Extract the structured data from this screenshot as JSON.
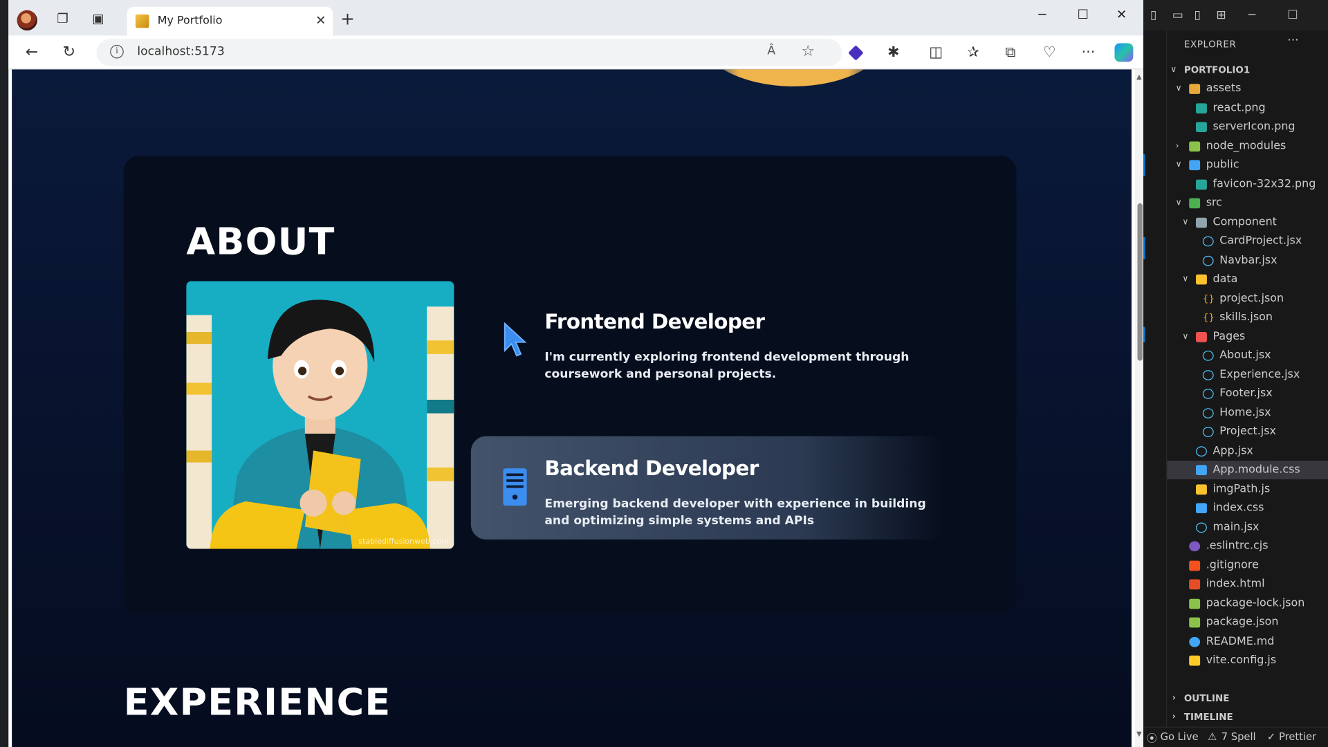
{
  "browser": {
    "tab_title": "My Portfolio",
    "new_tab_label": "+",
    "url": "localhost:5173",
    "read_aloud_label": "Â",
    "window_controls": {
      "minimize": "─",
      "maximize": "☐",
      "close": "✕"
    }
  },
  "page": {
    "about_title": "ABOUT",
    "avatar_watermark": "stablediffusionweb.com",
    "roles": [
      {
        "title": "Frontend Developer",
        "description": "I'm currently exploring frontend development through coursework and personal projects.",
        "icon": "cursor-icon"
      },
      {
        "title": "Backend Developer",
        "description": "Emerging backend developer with experience in building and optimizing simple systems and APIs",
        "icon": "server-icon"
      }
    ],
    "experience_title": "EXPERIENCE"
  },
  "vscode": {
    "explorer_label": "EXPLORER",
    "more_label": "···",
    "project_root": "PORTFOLIO1",
    "tree": [
      {
        "label": "assets",
        "depth": 1,
        "type": "folder-open",
        "color": "#e8a93b"
      },
      {
        "label": "react.png",
        "depth": 2,
        "type": "image",
        "color": "#26a69a"
      },
      {
        "label": "serverIcon.png",
        "depth": 2,
        "type": "image",
        "color": "#26a69a"
      },
      {
        "label": "node_modules",
        "depth": 1,
        "type": "folder-closed",
        "color": "#8bc34a"
      },
      {
        "label": "public",
        "depth": 1,
        "type": "folder-open",
        "color": "#42a5f5"
      },
      {
        "label": "favicon-32x32.png",
        "depth": 2,
        "type": "image",
        "color": "#26a69a"
      },
      {
        "label": "src",
        "depth": 1,
        "type": "folder-open",
        "color": "#4caf50"
      },
      {
        "label": "Component",
        "depth": 2,
        "type": "folder-open",
        "color": "#90a4ae"
      },
      {
        "label": "CardProject.jsx",
        "depth": 3,
        "type": "react",
        "color": "#4fc3f7"
      },
      {
        "label": "Navbar.jsx",
        "depth": 3,
        "type": "react",
        "color": "#4fc3f7"
      },
      {
        "label": "data",
        "depth": 2,
        "type": "folder-open",
        "color": "#fbc02d"
      },
      {
        "label": "project.json",
        "depth": 3,
        "type": "json",
        "color": "#f9a825"
      },
      {
        "label": "skills.json",
        "depth": 3,
        "type": "json",
        "color": "#f9a825"
      },
      {
        "label": "Pages",
        "depth": 2,
        "type": "folder-open",
        "color": "#ef5350"
      },
      {
        "label": "About.jsx",
        "depth": 3,
        "type": "react",
        "color": "#4fc3f7"
      },
      {
        "label": "Experience.jsx",
        "depth": 3,
        "type": "react",
        "color": "#4fc3f7"
      },
      {
        "label": "Footer.jsx",
        "depth": 3,
        "type": "react",
        "color": "#4fc3f7"
      },
      {
        "label": "Home.jsx",
        "depth": 3,
        "type": "react",
        "color": "#4fc3f7"
      },
      {
        "label": "Project.jsx",
        "depth": 3,
        "type": "react",
        "color": "#4fc3f7"
      },
      {
        "label": "App.jsx",
        "depth": 2,
        "type": "react",
        "color": "#4fc3f7"
      },
      {
        "label": "App.module.css",
        "depth": 2,
        "type": "css",
        "color": "#42a5f5",
        "selected": true
      },
      {
        "label": "imgPath.js",
        "depth": 2,
        "type": "js",
        "color": "#fbc02d"
      },
      {
        "label": "index.css",
        "depth": 2,
        "type": "css",
        "color": "#42a5f5"
      },
      {
        "label": "main.jsx",
        "depth": 2,
        "type": "react",
        "color": "#4fc3f7"
      },
      {
        "label": ".eslintrc.cjs",
        "depth": 1,
        "type": "eslint",
        "color": "#7e57c2"
      },
      {
        "label": ".gitignore",
        "depth": 1,
        "type": "git",
        "color": "#f4511e"
      },
      {
        "label": "index.html",
        "depth": 1,
        "type": "html",
        "color": "#e44d26"
      },
      {
        "label": "package-lock.json",
        "depth": 1,
        "type": "npm",
        "color": "#8bc34a"
      },
      {
        "label": "package.json",
        "depth": 1,
        "type": "npm",
        "color": "#8bc34a"
      },
      {
        "label": "README.md",
        "depth": 1,
        "type": "info",
        "color": "#42a5f5"
      },
      {
        "label": "vite.config.js",
        "depth": 1,
        "type": "vite",
        "color": "#ffca28"
      }
    ],
    "outline_label": "OUTLINE",
    "timeline_label": "TIMELINE",
    "status": {
      "go_live": "Go Live",
      "spell": "7 Spell",
      "prettier": "Prettier"
    }
  }
}
